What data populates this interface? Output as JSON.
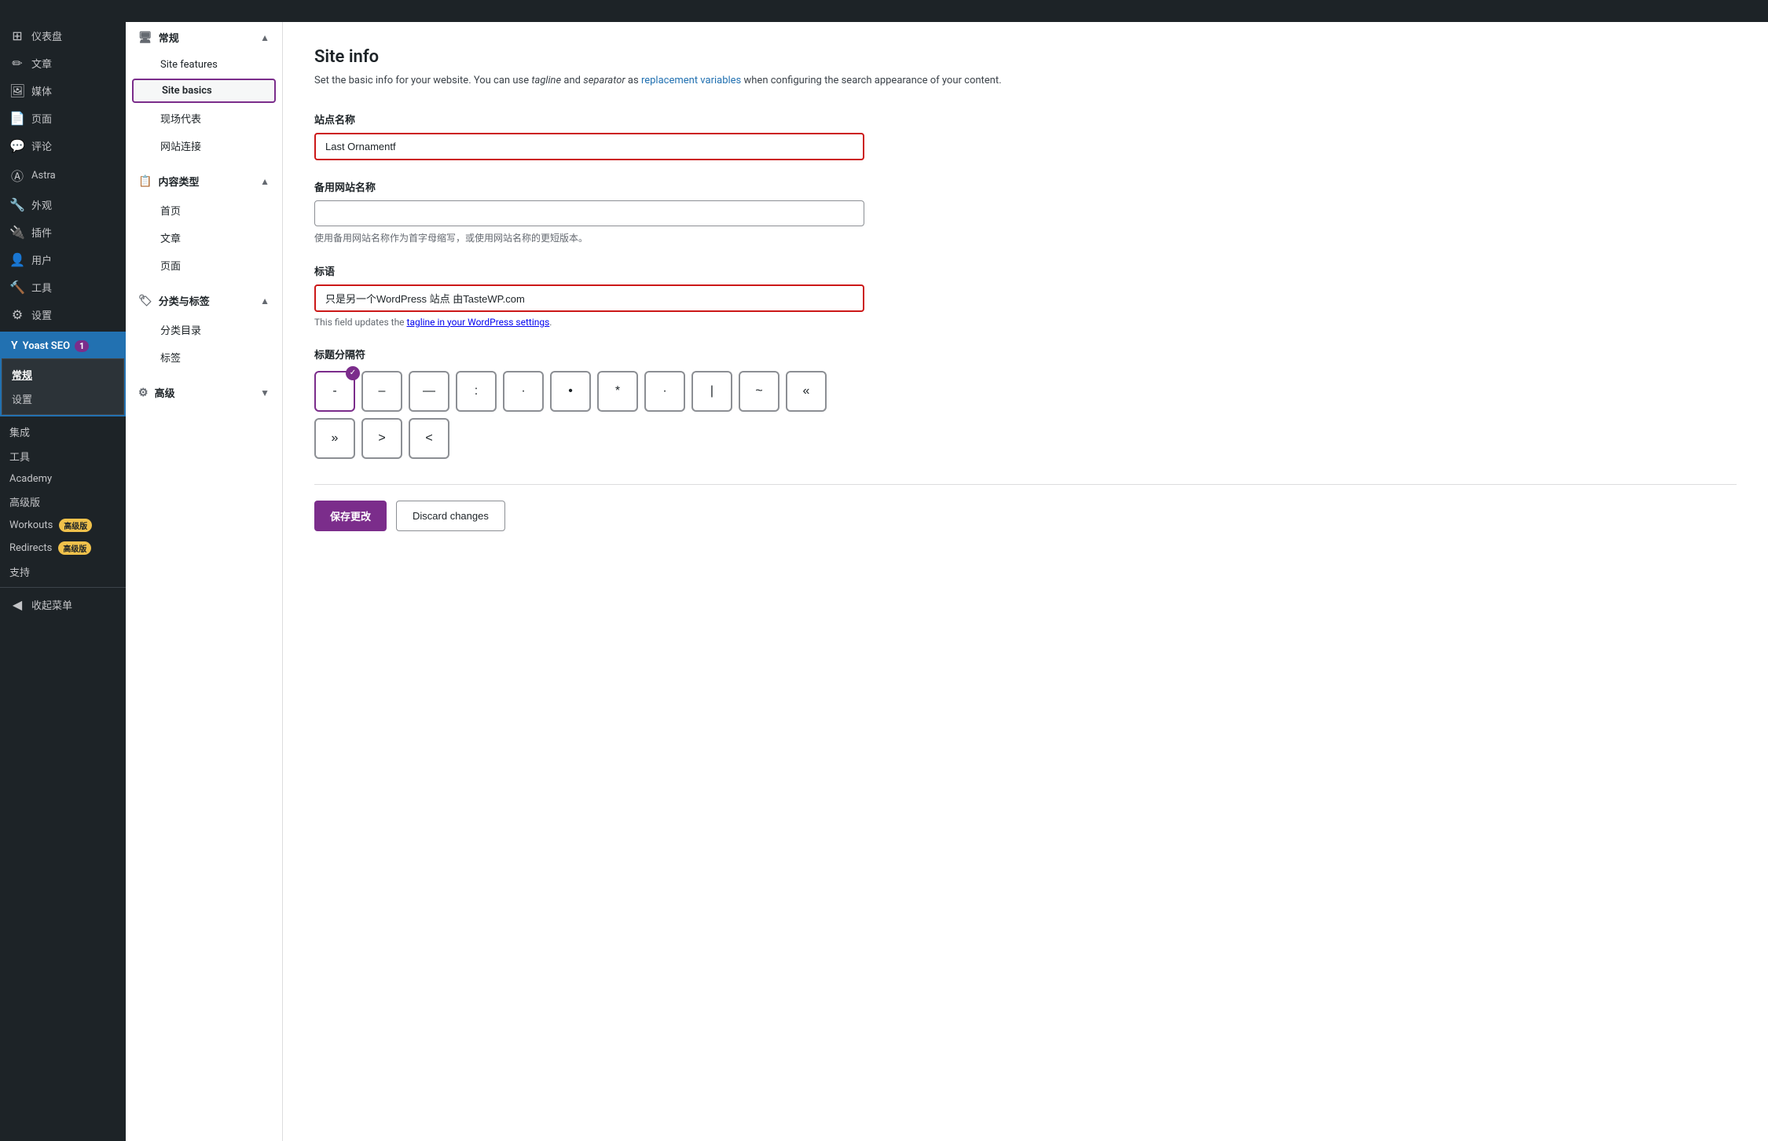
{
  "admin_bar": {},
  "sidebar": {
    "items": [
      {
        "id": "dashboard",
        "icon": "🏠",
        "label": "仪表盘"
      },
      {
        "id": "posts",
        "icon": "✏️",
        "label": "文章"
      },
      {
        "id": "media",
        "icon": "🖼",
        "label": "媒体"
      },
      {
        "id": "pages",
        "icon": "📄",
        "label": "页面"
      },
      {
        "id": "comments",
        "icon": "💬",
        "label": "评论"
      },
      {
        "id": "astra",
        "icon": "Ⓐ",
        "label": "Astra"
      },
      {
        "id": "appearance",
        "icon": "🔧",
        "label": "外观"
      },
      {
        "id": "plugins",
        "icon": "🔌",
        "label": "插件"
      },
      {
        "id": "users",
        "icon": "👤",
        "label": "用户"
      },
      {
        "id": "tools",
        "icon": "🔨",
        "label": "工具"
      },
      {
        "id": "settings",
        "icon": "⚙️",
        "label": "设置"
      }
    ],
    "yoast": {
      "label": "Yoast SEO",
      "badge": "1",
      "sub_items": [
        {
          "id": "general",
          "label": "常规",
          "active": true
        },
        {
          "id": "settings",
          "label": "设置",
          "active": false
        }
      ],
      "other_items": [
        {
          "id": "integrations",
          "label": "集成"
        },
        {
          "id": "tools",
          "label": "工具"
        },
        {
          "id": "academy",
          "label": "Academy"
        },
        {
          "id": "premium",
          "label": "高级版"
        },
        {
          "id": "workouts",
          "label": "Workouts",
          "badge": "高级版"
        },
        {
          "id": "redirects",
          "label": "Redirects",
          "badge": "高级版"
        },
        {
          "id": "support",
          "label": "支持"
        }
      ]
    },
    "collapse": "收起菜单"
  },
  "submenu": {
    "sections": [
      {
        "id": "general",
        "icon": "🖥",
        "label": "常规",
        "expanded": true,
        "items": [
          {
            "id": "site-features",
            "label": "Site features"
          },
          {
            "id": "site-basics",
            "label": "Site basics",
            "active": true
          },
          {
            "id": "venue-rep",
            "label": "现场代表"
          },
          {
            "id": "website-link",
            "label": "网站连接"
          }
        ]
      },
      {
        "id": "content-types",
        "icon": "📋",
        "label": "内容类型",
        "expanded": true,
        "items": [
          {
            "id": "homepage",
            "label": "首页"
          },
          {
            "id": "posts",
            "label": "文章"
          },
          {
            "id": "pages",
            "label": "页面"
          }
        ]
      },
      {
        "id": "categories-tags",
        "icon": "🏷",
        "label": "分类与标签",
        "expanded": true,
        "items": [
          {
            "id": "category-archive",
            "label": "分类目录"
          },
          {
            "id": "tags",
            "label": "标签"
          }
        ]
      },
      {
        "id": "advanced",
        "icon": "⚙",
        "label": "高级",
        "expanded": false,
        "items": []
      }
    ]
  },
  "main": {
    "title": "Site info",
    "description_prefix": "Set the basic info for your website. You can use ",
    "description_tagline": "tagline",
    "description_and": " and ",
    "description_separator": "separator",
    "description_as": " as ",
    "description_link": "replacement variables",
    "description_suffix": " when configuring the search appearance of your content.",
    "fields": {
      "site_name": {
        "label": "站点名称",
        "value": "Last Ornamentf",
        "placeholder": ""
      },
      "alt_site_name": {
        "label": "备用网站名称",
        "value": "",
        "placeholder": "",
        "hint": "使用备用网站名称作为首字母缩写，或使用网站名称的更短版本。"
      },
      "tagline": {
        "label": "标语",
        "value": "只是另一个WordPress 站点 由TasteWP.com",
        "placeholder": "",
        "hint_prefix": "This field updates the ",
        "hint_link": "tagline in your WordPress settings",
        "hint_suffix": "."
      },
      "separator": {
        "label": "标题分隔符",
        "options": [
          {
            "id": "dash-short",
            "char": "-",
            "selected": true
          },
          {
            "id": "dash-medium",
            "char": "–",
            "selected": false
          },
          {
            "id": "dash-long",
            "char": "—",
            "selected": false
          },
          {
            "id": "colon",
            "char": ":",
            "selected": false
          },
          {
            "id": "dot-large",
            "char": "·",
            "selected": false
          },
          {
            "id": "dot-middle",
            "char": "•",
            "selected": false
          },
          {
            "id": "asterisk",
            "char": "*",
            "selected": false
          },
          {
            "id": "dot-small",
            "char": "·",
            "selected": false
          },
          {
            "id": "pipe",
            "char": "|",
            "selected": false
          },
          {
            "id": "tilde",
            "char": "~",
            "selected": false
          },
          {
            "id": "guillemet-left",
            "char": "«",
            "selected": false
          },
          {
            "id": "guillemet-right",
            "char": "»",
            "selected": false
          },
          {
            "id": "angle-right",
            "char": ">",
            "selected": false
          },
          {
            "id": "angle-left",
            "char": "<",
            "selected": false
          }
        ]
      }
    },
    "buttons": {
      "save": "保存更改",
      "discard": "Discard changes"
    }
  }
}
